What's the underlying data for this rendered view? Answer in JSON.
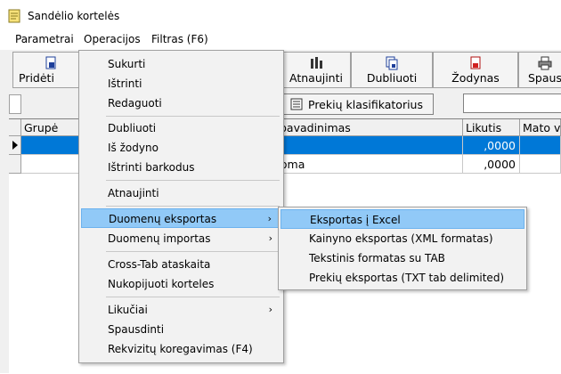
{
  "window": {
    "title": "Sandėlio kortelės"
  },
  "menubar": {
    "items": [
      "Parametrai",
      "Operacijos",
      "Filtras (F6)"
    ]
  },
  "toolbar": {
    "buttons": [
      {
        "label": "Pridėti",
        "icon": "add-doc-icon"
      },
      {
        "label": "Atnaujinti",
        "icon": "refresh-icon"
      },
      {
        "label": "Dubliuoti",
        "icon": "duplicate-icon"
      },
      {
        "label": "Žodynas",
        "icon": "dictionary-icon"
      },
      {
        "label": "Spausdinti",
        "icon": "printer-icon"
      }
    ],
    "classifier_label": "Prekių klasifikatorius"
  },
  "grid": {
    "columns": [
      "Grupė",
      "pavadinimas",
      "Likutis",
      "Mato vi"
    ],
    "rows": [
      {
        "name": "",
        "likutis": ",0000",
        "selected": true
      },
      {
        "name": "toma",
        "likutis": ",0000",
        "selected": false
      }
    ]
  },
  "operacijos_menu": {
    "items": [
      {
        "label": "Sukurti"
      },
      {
        "label": "Ištrinti"
      },
      {
        "label": "Redaguoti"
      },
      {
        "label": "Dubliuoti"
      },
      {
        "label": "Iš žodyno"
      },
      {
        "label": "Ištrinti barkodus"
      },
      {
        "label": "Atnaujinti"
      },
      {
        "label": "Duomenų eksportas",
        "submenu": true,
        "highlighted": true
      },
      {
        "label": "Duomenų importas",
        "submenu": true
      },
      {
        "label": "Cross-Tab ataskaita"
      },
      {
        "label": "Nukopijuoti korteles"
      },
      {
        "label": "Likučiai",
        "submenu": true
      },
      {
        "label": "Spausdinti"
      },
      {
        "label": "Rekvizitų koregavimas (F4)"
      }
    ]
  },
  "export_submenu": {
    "items": [
      {
        "label": "Eksportas į Excel",
        "highlighted": true
      },
      {
        "label": "Kainyno eksportas (XML formatas)"
      },
      {
        "label": "Tekstinis formatas su TAB"
      },
      {
        "label": "Prekių eksportas (TXT tab delimited)"
      }
    ]
  },
  "colors": {
    "selection": "#0078d7",
    "menu_highlight": "#91c9f7"
  }
}
